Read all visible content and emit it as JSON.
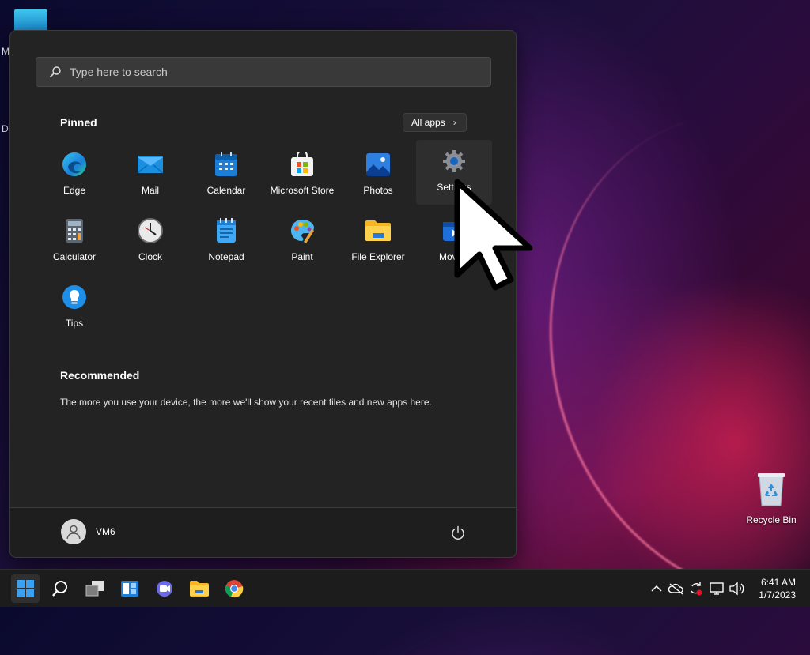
{
  "desktop": {
    "edge_labels": [
      "M",
      "Da"
    ],
    "recycle_bin_label": "Recycle Bin"
  },
  "start_menu": {
    "search": {
      "placeholder": "Type here to search"
    },
    "pinned": {
      "title": "Pinned",
      "all_apps_label": "All apps",
      "apps": [
        {
          "label": "Edge",
          "icon": "edge-icon"
        },
        {
          "label": "Mail",
          "icon": "mail-icon"
        },
        {
          "label": "Calendar",
          "icon": "calendar-icon"
        },
        {
          "label": "Microsoft Store",
          "icon": "store-icon"
        },
        {
          "label": "Photos",
          "icon": "photos-icon"
        },
        {
          "label": "Settings",
          "icon": "gear-icon"
        },
        {
          "label": "Calculator",
          "icon": "calculator-icon"
        },
        {
          "label": "Clock",
          "icon": "clock-icon"
        },
        {
          "label": "Notepad",
          "icon": "notepad-icon"
        },
        {
          "label": "Paint",
          "icon": "paint-icon"
        },
        {
          "label": "File Explorer",
          "icon": "folder-icon"
        },
        {
          "label": "Movies",
          "icon": "movies-icon"
        },
        {
          "label": "Tips",
          "icon": "lightbulb-icon"
        }
      ]
    },
    "recommended": {
      "title": "Recommended",
      "text": "The more you use your device, the more we'll show your recent files and new apps here."
    },
    "user": {
      "name": "VM6"
    }
  },
  "taskbar": {
    "time": "6:41 AM",
    "date": "1/7/2023"
  },
  "colors": {
    "menu_bg": "#232323",
    "accent": "#0a84ff",
    "taskbar_bg": "#1c1c1c"
  }
}
